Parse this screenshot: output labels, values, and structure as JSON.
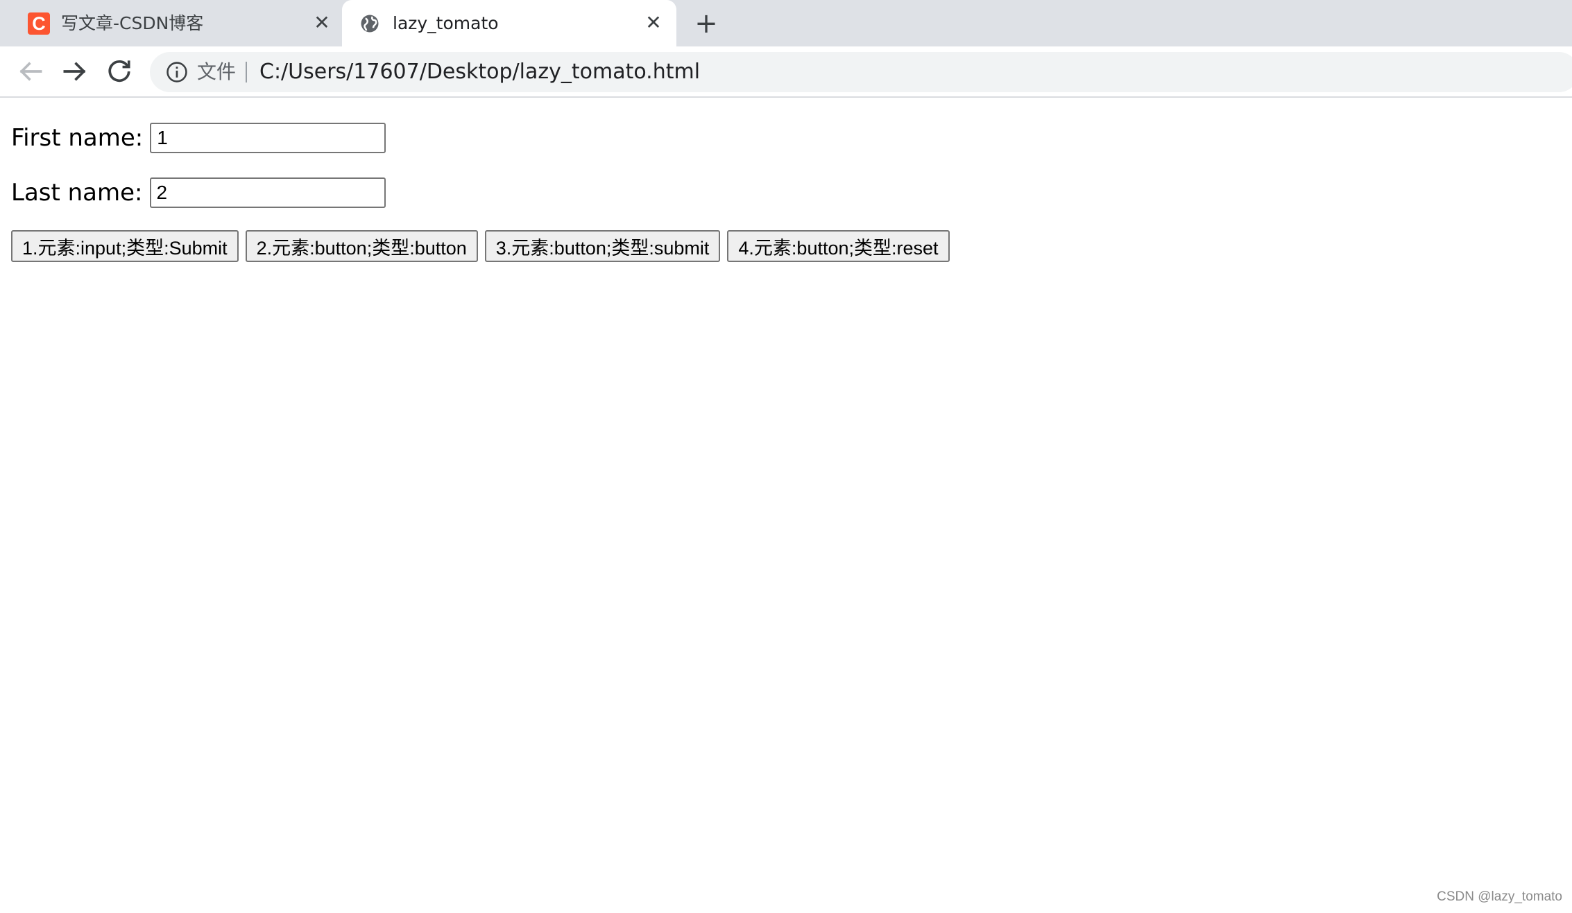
{
  "browser": {
    "tabs": [
      {
        "title": "写文章-CSDN博客",
        "favicon": "csdn-icon",
        "favicon_text": "C",
        "active": false
      },
      {
        "title": "lazy_tomato",
        "favicon": "globe-icon",
        "active": true
      }
    ],
    "close_glyph": "✕",
    "new_tab_glyph": "+",
    "scheme_label": "文件",
    "url": "C:/Users/17607/Desktop/lazy_tomato.html",
    "colors": {
      "tabstrip": "#dee1e6",
      "csdn_brand": "#fc5531"
    }
  },
  "form": {
    "first_name_label": "First name:",
    "first_name_value": "1",
    "last_name_label": "Last name:",
    "last_name_value": "2",
    "buttons": [
      "1.元素:input;类型:Submit",
      "2.元素:button;类型:button",
      "3.元素:button;类型:submit",
      "4.元素:button;类型:reset"
    ]
  },
  "watermark": "CSDN @lazy_tomato"
}
